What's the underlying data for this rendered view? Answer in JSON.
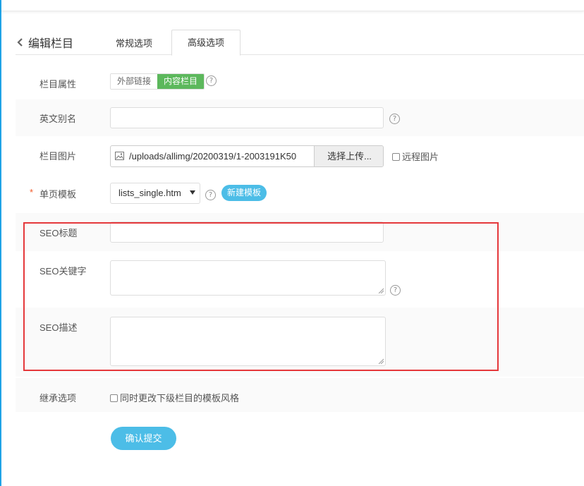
{
  "header": {
    "back_title": "编辑栏目",
    "tabs": [
      {
        "label": "常规选项",
        "active": false
      },
      {
        "label": "高级选项",
        "active": true
      }
    ]
  },
  "form": {
    "attribute": {
      "label": "栏目属性",
      "options": [
        "外部链接",
        "内容栏目"
      ],
      "selected": "内容栏目"
    },
    "alias": {
      "label": "英文别名",
      "value": ""
    },
    "image": {
      "label": "栏目图片",
      "path": "/uploads/allimg/20200319/1-2003191K50",
      "upload_button": "选择上传...",
      "remote_label": "远程图片"
    },
    "template": {
      "label": "单页模板",
      "required_mark": "*",
      "selected": "lists_single.htm",
      "new_button": "新建模板"
    },
    "seo_title": {
      "label": "SEO标题",
      "value": ""
    },
    "seo_keywords": {
      "label": "SEO关键字",
      "value": ""
    },
    "seo_description": {
      "label": "SEO描述",
      "value": ""
    },
    "inherit": {
      "label": "继承选项",
      "checkbox_label": "同时更改下级栏目的模板风格",
      "checked": false
    }
  },
  "submit_label": "确认提交",
  "help_glyph": "?",
  "colors": {
    "accent": "#4cbde7",
    "selected_segment": "#5cb85c",
    "highlight_border": "#e5383b",
    "required": "#f25a29"
  }
}
